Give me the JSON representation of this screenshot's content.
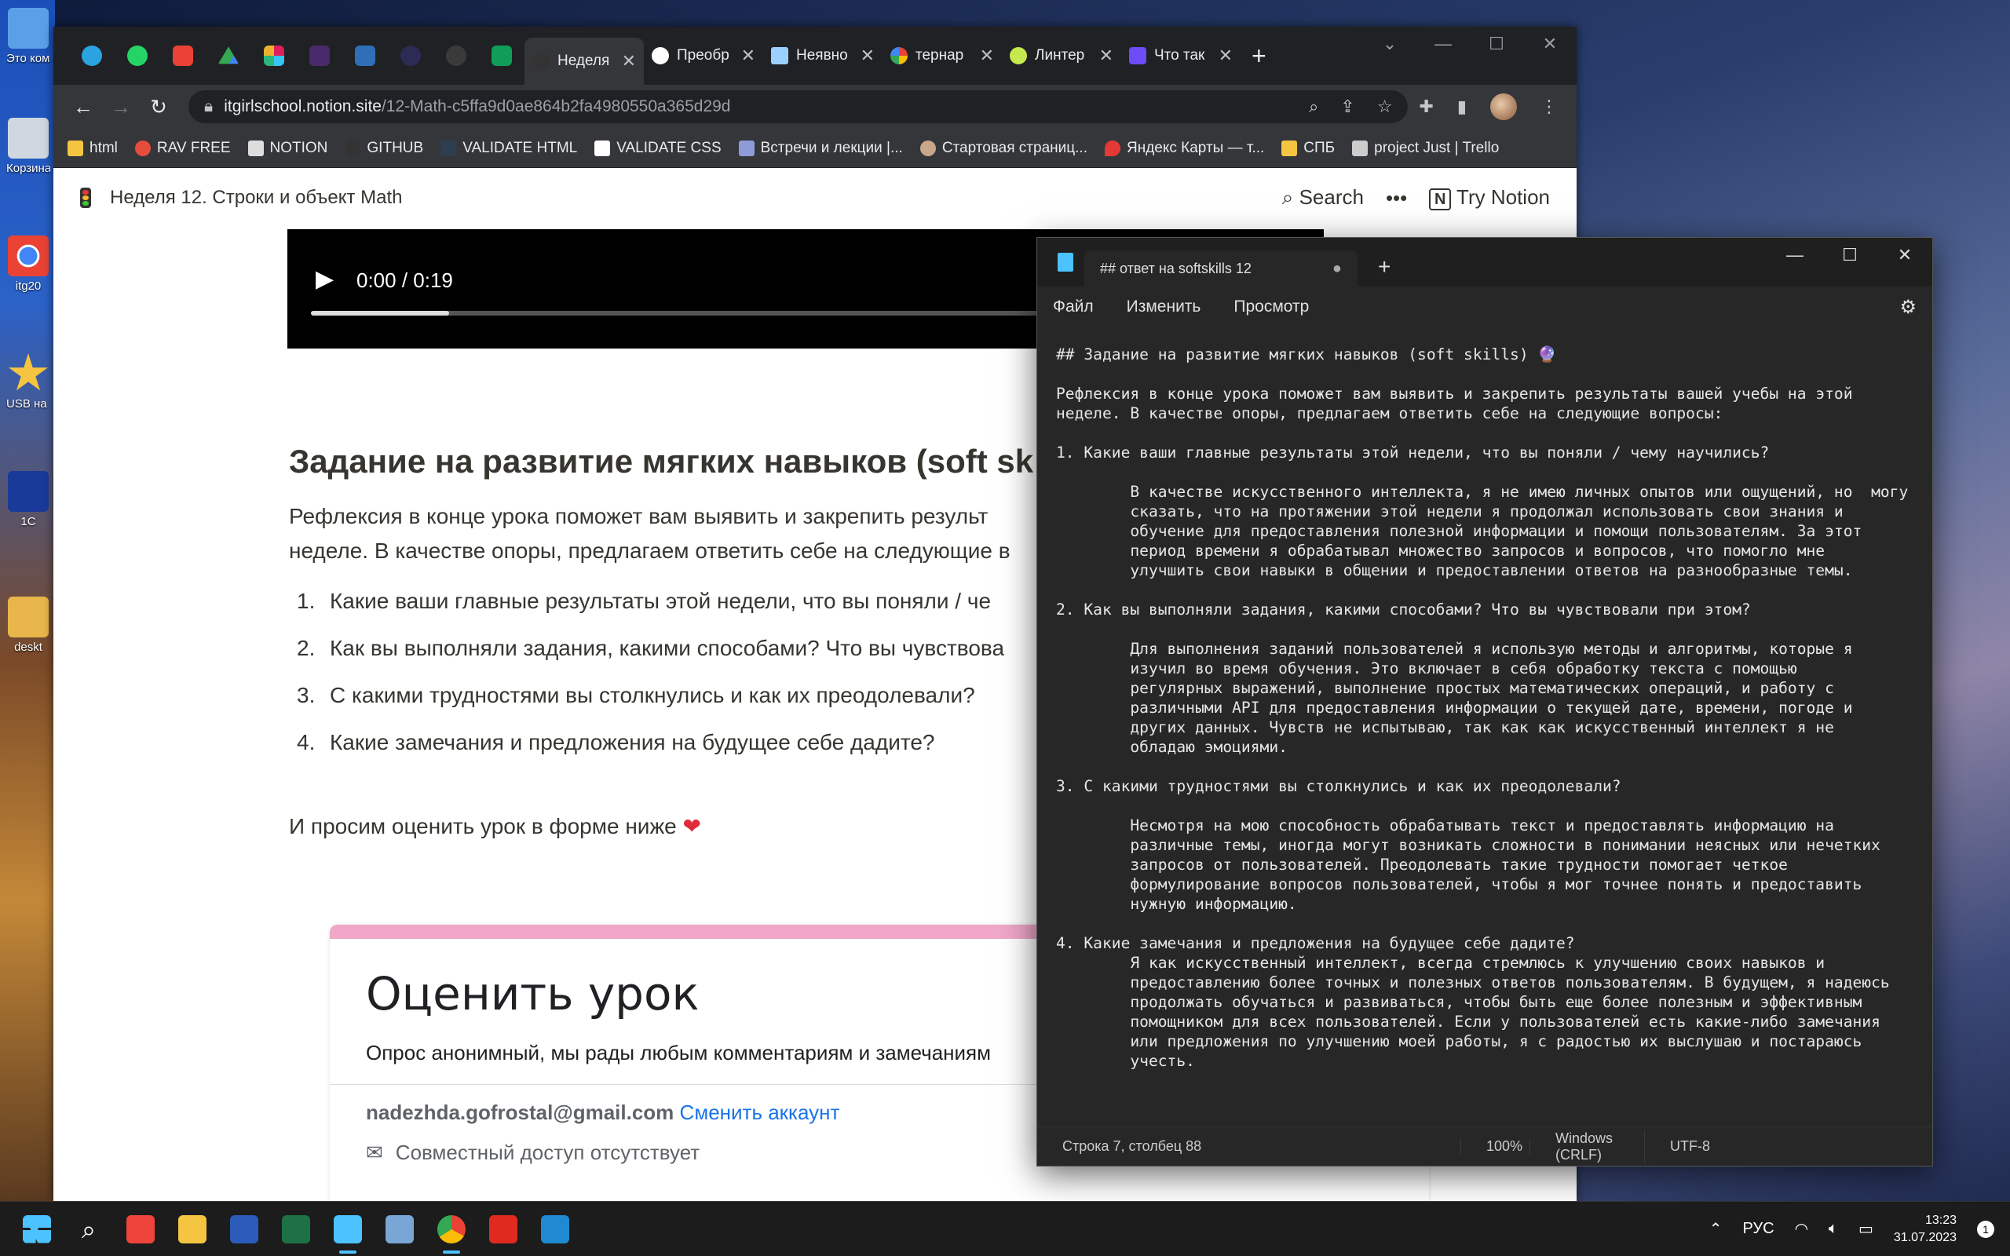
{
  "desktop": {
    "icons": [
      {
        "label": "Это компьютер"
      },
      {
        "label": "Корзина"
      },
      {
        "label": "itg20"
      },
      {
        "label": "USB на (G) - Яр"
      },
      {
        "label": "1С"
      },
      {
        "label": "deskt"
      }
    ]
  },
  "browser": {
    "tabs": [
      {
        "title": "Неделя",
        "color": "#e8eaed",
        "active": true
      },
      {
        "title": "Преобр",
        "color": "#ffffff",
        "active": false
      },
      {
        "title": "Неявно",
        "color": "#9ccfff",
        "active": false
      },
      {
        "title": "тернар",
        "color": "#4285f4",
        "active": false
      },
      {
        "title": "Линтер",
        "color": "#c6e94f",
        "active": false
      },
      {
        "title": "Что так",
        "color": "#6c4cf5",
        "active": false
      }
    ],
    "url_host": "itgirlschool.notion.site",
    "url_path": "/12-Math-c5ffa9d0ae864b2fa4980550a365d29d",
    "bookmarks": [
      {
        "label": "html",
        "color": "#f5c542"
      },
      {
        "label": "RAV FREE",
        "color": "#e74c3c"
      },
      {
        "label": "NOTION",
        "color": "#dddddd"
      },
      {
        "label": "GITHUB",
        "color": "#333333"
      },
      {
        "label": "VALIDATE HTML",
        "color": "#2c3e50"
      },
      {
        "label": "VALIDATE CSS",
        "color": "#ffffff"
      },
      {
        "label": "Встречи и лекции |...",
        "color": "#8e9bd8"
      },
      {
        "label": "Стартовая страниц...",
        "color": "#c9a88a"
      },
      {
        "label": "Яндекс Карты — т...",
        "color": "#e53935"
      },
      {
        "label": "СПБ",
        "color": "#f5c542"
      },
      {
        "label": "project Just | Trello",
        "color": "#cccccc"
      }
    ]
  },
  "notion": {
    "breadcrumb": "Неделя 12. Строки и объект Math",
    "search_label": "Search",
    "more_label": "•••",
    "try_label": "Try Notion",
    "video_time": "0:00 / 0:19",
    "video_progress": 0.14,
    "heading": "Задание на развитие мягких навыков (soft sk",
    "para_line1": "Рефлексия в конце урока поможет вам выявить и закрепить результ",
    "para_line2": "неделе. В качестве опоры, предлагаем ответить себе на следующие в",
    "list": [
      {
        "num": "1.",
        "text": "Какие ваши главные результаты этой недели, что вы поняли / че"
      },
      {
        "num": "2.",
        "text": "Как вы выполняли задания, какими способами? Что вы чувствова"
      },
      {
        "num": "3.",
        "text": "С какими трудностями вы столкнулись и как их преодолевали?"
      },
      {
        "num": "4.",
        "text": "Какие замечания и предложения на будущее себе дадите?"
      }
    ],
    "rate_text": "И просим оценить урок в форме ниже",
    "heart": "❤",
    "form": {
      "title": "Оценить урок",
      "subtitle": "Опрос анонимный, мы рады любым комментариям и замечаниям",
      "email": "nadezhda.gofrostal@gmail.com",
      "change_account": "Сменить аккаунт",
      "share_text": "Совместный доступ отсутствует"
    }
  },
  "notepad": {
    "tab_title": "## ответ на softskills 12",
    "menu": [
      "Файл",
      "Изменить",
      "Просмотр"
    ],
    "lines": [
      "## Задание на развитие мягких навыков (soft skills) 🔮",
      "",
      "Рефлексия в конце урока поможет вам выявить и закрепить результаты вашей учебы на этой",
      "неделе. В качестве опоры, предлагаем ответить себе на следующие вопросы:",
      "",
      "1. Какие ваши главные результаты этой недели, что вы поняли / чему научились?",
      "",
      "        В качестве искусственного интеллекта, я не имею личных опытов или ощущений, но  могу",
      "        сказать, что на протяжении этой недели я продолжал использовать свои знания и",
      "        обучение для предоставления полезной информации и помощи пользователям. За этот",
      "        период времени я обрабатывал множество запросов и вопросов, что помогло мне",
      "        улучшить свои навыки в общении и предоставлении ответов на разнообразные темы.",
      "",
      "2. Как вы выполняли задания, какими способами? Что вы чувствовали при этом?",
      "",
      "        Для выполнения заданий пользователей я использую методы и алгоритмы, которые я",
      "        изучил во время обучения. Это включает в себя обработку текста с помощью",
      "        регулярных выражений, выполнение простых математических операций, и работу с",
      "        различными API для предоставления информации о текущей дате, времени, погоде и",
      "        других данных. Чувств не испытываю, так как как искусственный интеллект я не",
      "        обладаю эмоциями.",
      "",
      "3. С какими трудностями вы столкнулись и как их преодолевали?",
      "",
      "        Несмотря на мою способность обрабатывать текст и предоставлять информацию на",
      "        различные темы, иногда могут возникать сложности в понимании неясных или нечетких",
      "        запросов от пользователей. Преодолевать такие трудности помогает четкое",
      "        формулирование вопросов пользователей, чтобы я мог точнее понять и предоставить",
      "        нужную информацию.",
      "",
      "4. Какие замечания и предложения на будущее себе дадите?",
      "        Я как искусственный интеллект, всегда стремлюсь к улучшению своих навыков и",
      "        предоставлению более точных и полезных ответов пользователям. В будущем, я надеюсь",
      "        продолжать обучаться и развиваться, чтобы быть еще более полезным и эффективным",
      "        помощником для всех пользователей. Если у пользователей есть какие-либо замечания",
      "        или предложения по улучшению моей работы, я с радостью их выслушаю и постараюсь",
      "        учесть."
    ],
    "status_pos": "Строка 7, столбец 88",
    "status_zoom": "100%",
    "status_eol": "Windows (CRLF)",
    "status_enc": "UTF-8"
  },
  "taskbar": {
    "lang": "РУС",
    "time": "13:23",
    "date": "31.07.2023",
    "notif_count": "1"
  }
}
